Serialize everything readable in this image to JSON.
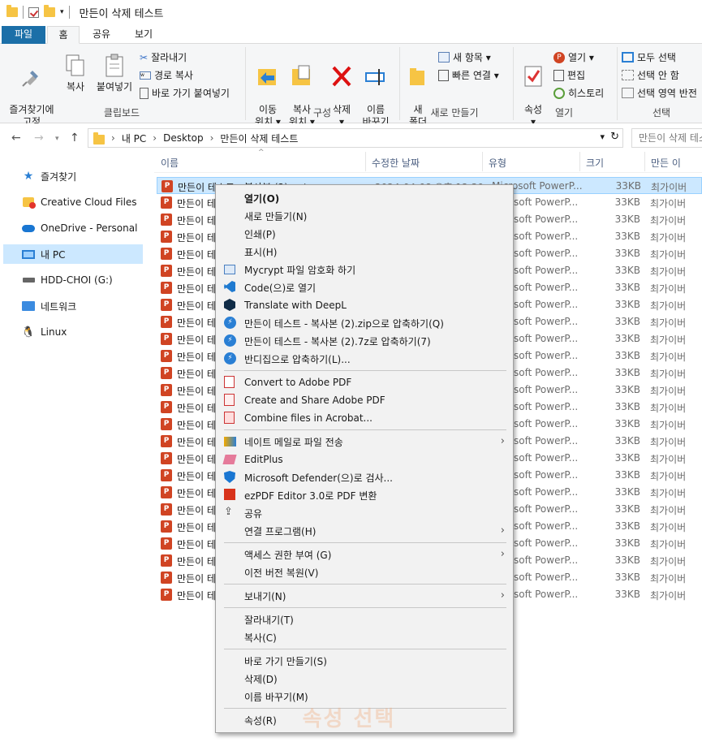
{
  "window": {
    "title": "만든이 삭제 테스트"
  },
  "tabs": [
    {
      "label": "파일"
    },
    {
      "label": "홈"
    },
    {
      "label": "공유"
    },
    {
      "label": "보기"
    }
  ],
  "ribbon": {
    "clipboard": {
      "pin": "즐겨찾기에\n고정",
      "copy": "복사",
      "paste": "붙여넣기",
      "cut": "잘라내기",
      "copy_path": "경로 복사",
      "paste_shortcut": "바로 가기 붙여넣기",
      "group": "클립보드"
    },
    "organize": {
      "move": "이동\n위치 ▾",
      "copy_to": "복사\n위치 ▾",
      "delete": "삭제\n▾",
      "rename": "이름\n바꾸기",
      "group": "구성"
    },
    "new": {
      "new_folder": "새\n폴더",
      "new_item": "새 항목 ▾",
      "easy_access": "빠른 연결 ▾",
      "group": "새로 만들기"
    },
    "open": {
      "properties": "속성\n▾",
      "open": "열기 ▾",
      "edit": "편집",
      "history": "히스토리",
      "group": "열기"
    },
    "select": {
      "select_all": "모두 선택",
      "select_none": "선택 안 함",
      "invert": "선택 영역 반전",
      "group": "선택"
    }
  },
  "address": {
    "crumbs": [
      "내 PC",
      "Desktop",
      "만든이 삭제 테스트"
    ],
    "search_placeholder": "만든이 삭제 테스트 검색"
  },
  "sidebar": [
    {
      "label": "즐겨찾기",
      "icon": "star-icon"
    },
    {
      "label": "Creative Cloud Files",
      "icon": "creative-cloud-icon"
    },
    {
      "label": "OneDrive - Personal",
      "icon": "cloud-icon"
    },
    {
      "label": "내 PC",
      "icon": "computer-icon",
      "selected": true
    },
    {
      "label": "HDD-CHOI (G:)",
      "icon": "drive-icon"
    },
    {
      "label": "네트워크",
      "icon": "network-icon"
    },
    {
      "label": "Linux",
      "icon": "linux-icon"
    }
  ],
  "columns": [
    "이름",
    "수정한 날짜",
    "유형",
    "크기",
    "만든 이"
  ],
  "file_row": {
    "name": "만든이 테",
    "first_name": "만든이 테스트 - 복사본 (2).pptx",
    "first_date": "2024-04-08 오후 12:30",
    "type": "soft PowerP...",
    "first_type": "Microsoft PowerP...",
    "size": "33KB",
    "author": "최가이버"
  },
  "context_menu": {
    "items": [
      {
        "label": "열기(O)",
        "bold": true
      },
      {
        "label": "새로 만들기(N)"
      },
      {
        "label": "인쇄(P)"
      },
      {
        "label": "표시(H)"
      },
      {
        "label": "Mycrypt 파일 암호화 하기",
        "icon": "mycrypt-icon"
      },
      {
        "label": "Code(으)로 열기",
        "icon": "vscode-icon"
      },
      {
        "label": "Translate with DeepL",
        "icon": "deepl-icon"
      },
      {
        "label": "만든이 테스트 - 복사본 (2).zip으로 압축하기(Q)",
        "icon": "bandizip-icon"
      },
      {
        "label": "만든이 테스트 - 복사본 (2).7z로 압축하기(7)",
        "icon": "bandizip-icon"
      },
      {
        "label": "반디집으로 압축하기(L)...",
        "icon": "bandizip-icon"
      },
      {
        "sep": true
      },
      {
        "label": "Convert to Adobe PDF",
        "icon": "adobe-pdf-icon"
      },
      {
        "label": "Create and Share Adobe PDF",
        "icon": "adobe-pdf-share-icon"
      },
      {
        "label": "Combine files in Acrobat...",
        "icon": "acrobat-combine-icon"
      },
      {
        "sep": true
      },
      {
        "label": "네이트 메일로 파일 전송",
        "icon": "nate-mail-icon",
        "submenu": true
      },
      {
        "label": "EditPlus",
        "icon": "editplus-icon"
      },
      {
        "label": "Microsoft Defender(으)로 검사...",
        "icon": "defender-icon"
      },
      {
        "label": "ezPDF Editor 3.0로 PDF 변환",
        "icon": "ezpdf-icon"
      },
      {
        "label": "공유",
        "icon": "share-icon"
      },
      {
        "label": "연결 프로그램(H)",
        "submenu": true
      },
      {
        "sep": true
      },
      {
        "label": "액세스 권한 부여 (G)",
        "submenu": true
      },
      {
        "label": "이전 버전 복원(V)"
      },
      {
        "sep": true
      },
      {
        "label": "보내기(N)",
        "submenu": true
      },
      {
        "sep": true
      },
      {
        "label": "잘라내기(T)"
      },
      {
        "label": "복사(C)"
      },
      {
        "sep": true
      },
      {
        "label": "바로 가기 만들기(S)"
      },
      {
        "label": "삭제(D)"
      },
      {
        "label": "이름 바꾸기(M)"
      },
      {
        "sep": true
      },
      {
        "label": "속성(R)"
      }
    ]
  },
  "watermark": "속성 선택",
  "colors": {
    "accent": "#1b6fa8",
    "selection": "#cce8ff",
    "ppt": "#d04423"
  }
}
